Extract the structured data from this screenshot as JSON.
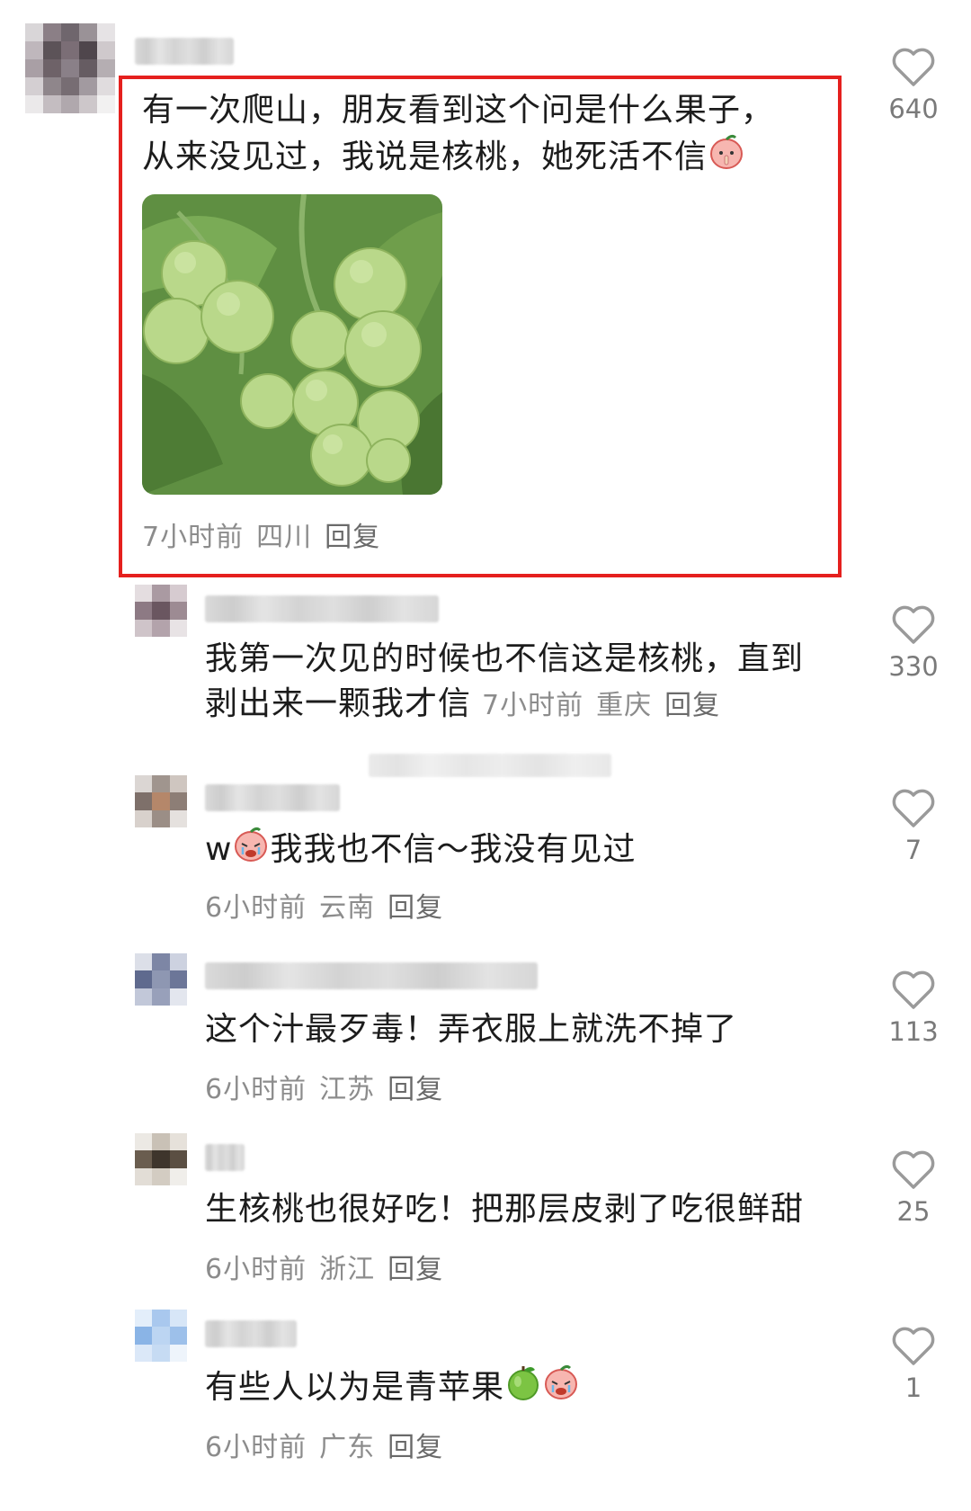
{
  "comments": [
    {
      "text_lines": [
        "有一次爬山，朋友看到这个问是什么果子，",
        "从来没见过，我说是核桃，她死活不信"
      ],
      "emoji": "peach-shush-emoji",
      "time": "7小时前",
      "location": "四川",
      "reply": "回复",
      "likes": "640",
      "image": "green-walnuts-photo"
    },
    {
      "text_lines": [
        "我第一次见的时候也不信这是核桃，直到",
        "剥出来一颗我才信"
      ],
      "time": "7小时前",
      "location": "重庆",
      "reply": "回复",
      "likes": "330"
    },
    {
      "text": "w",
      "text_after": "我我也不信～我没有见过",
      "emoji": "peach-cry-emoji",
      "time": "6小时前",
      "location": "云南",
      "reply": "回复",
      "likes": "7"
    },
    {
      "text": "这个汁最歹毒！弄衣服上就洗不掉了",
      "time": "6小时前",
      "location": "江苏",
      "reply": "回复",
      "likes": "113"
    },
    {
      "text": "生核桃也很好吃！把那层皮剥了吃很鲜甜",
      "time": "6小时前",
      "location": "浙江",
      "reply": "回复",
      "likes": "25"
    },
    {
      "text": "有些人以为是青苹果",
      "emoji": "green-apple-emoji",
      "emoji2": "peach-cry-emoji",
      "time": "6小时前",
      "location": "广东",
      "reply": "回复",
      "likes": "1"
    }
  ],
  "colors": {
    "highlight": "#e5201e",
    "meta": "#8c8c8c",
    "text": "#1c1c1c"
  }
}
